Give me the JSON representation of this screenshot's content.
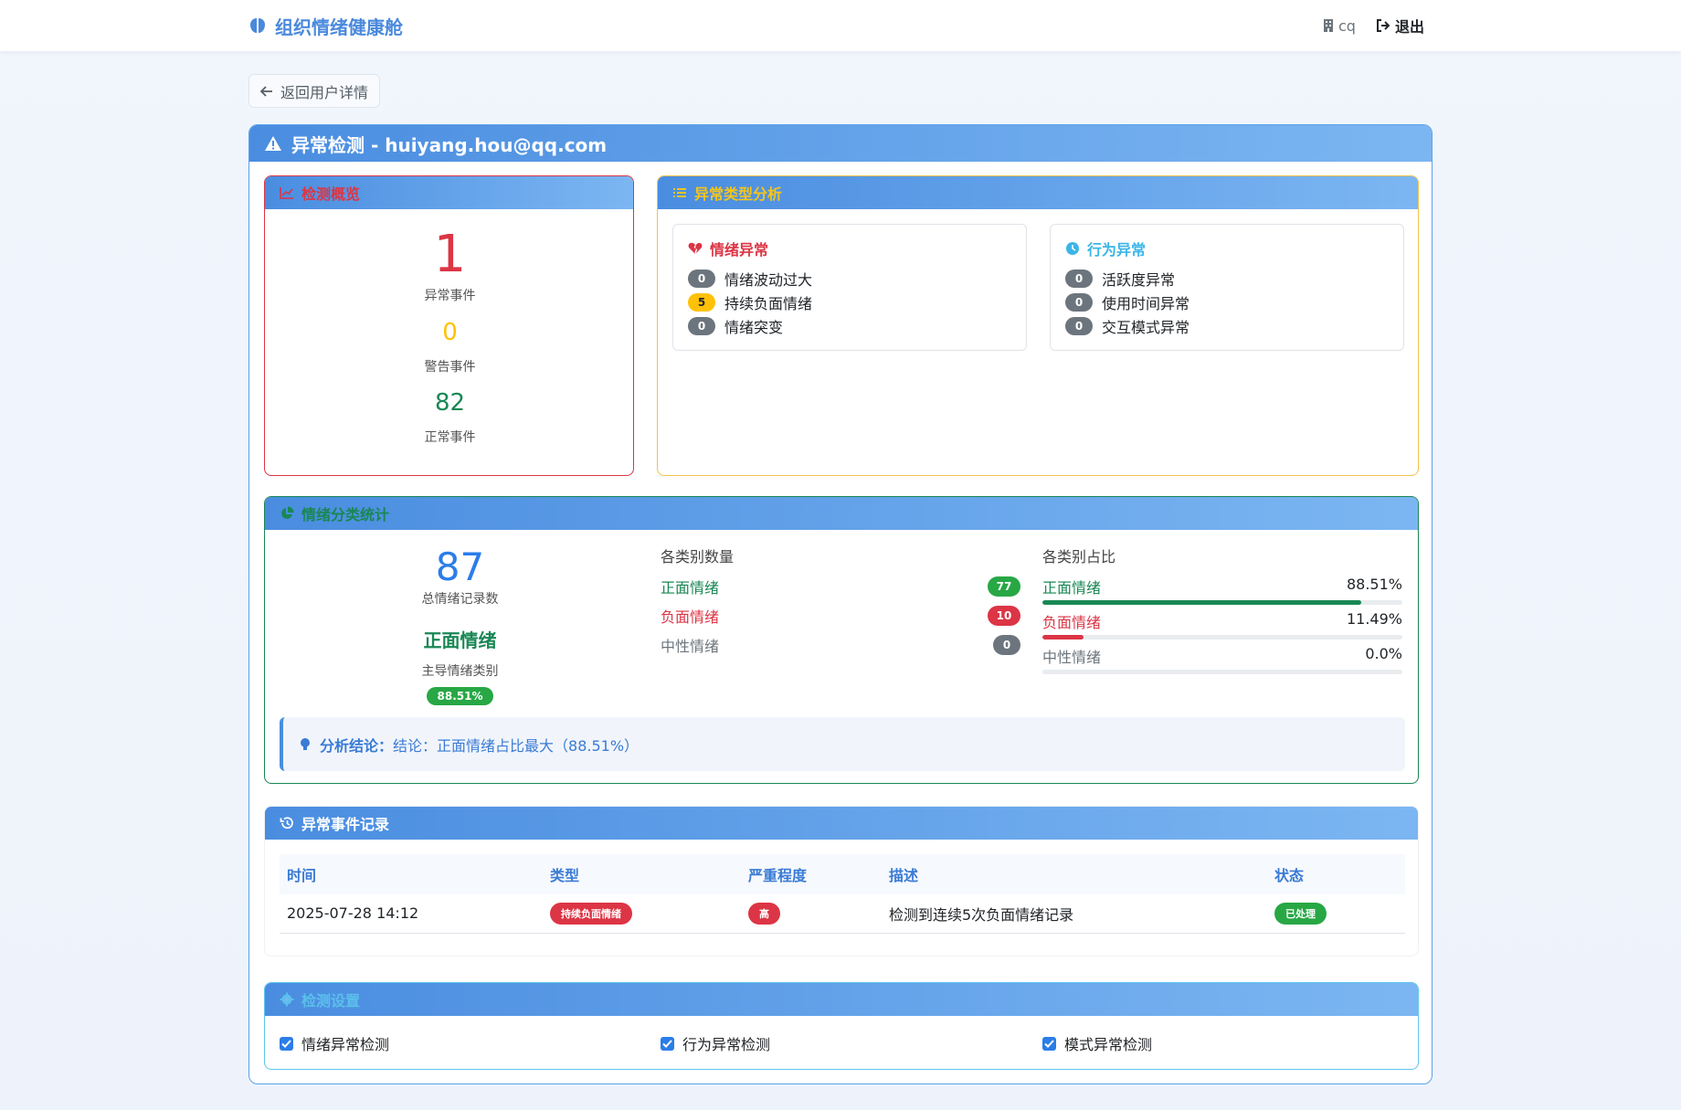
{
  "nav": {
    "brand": "组织情绪健康舱",
    "user": "cq",
    "logout": "退出"
  },
  "back": {
    "label": "返回用户详情"
  },
  "main": {
    "title": "异常检测 - huiyang.hou@qq.com"
  },
  "overview": {
    "title": "检测概览",
    "stats": [
      {
        "value": "1",
        "label": "异常事件",
        "color": "#dc3545"
      },
      {
        "value": "0",
        "label": "警告事件",
        "color": "#ffc107"
      },
      {
        "value": "82",
        "label": "正常事件",
        "color": "#198754"
      }
    ]
  },
  "types": {
    "title": "异常类型分析",
    "emotion": {
      "title": "情绪异常",
      "items": [
        {
          "count": "0",
          "label": "情绪波动过大"
        },
        {
          "count": "5",
          "label": "持续负面情绪"
        },
        {
          "count": "0",
          "label": "情绪突变"
        }
      ]
    },
    "behavior": {
      "title": "行为异常",
      "items": [
        {
          "count": "0",
          "label": "活跃度异常"
        },
        {
          "count": "0",
          "label": "使用时间异常"
        },
        {
          "count": "0",
          "label": "交互模式异常"
        }
      ]
    }
  },
  "emotion_stats": {
    "title": "情绪分类统计",
    "total": "87",
    "total_label": "总情绪记录数",
    "main_category": "正面情绪",
    "main_label": "主导情绪类别",
    "main_pct": "88.51%",
    "count_title": "各类别数量",
    "pct_title": "各类别占比",
    "categories": [
      {
        "name": "正面情绪",
        "count": "77",
        "pct": "88.51%",
        "fraction": 0.8851,
        "color": "#198754",
        "badge": "#28a745"
      },
      {
        "name": "负面情绪",
        "count": "10",
        "pct": "11.49%",
        "fraction": 0.1149,
        "color": "#dc3545",
        "badge": "#dc3545"
      },
      {
        "name": "中性情绪",
        "count": "0",
        "pct": "0.0%",
        "fraction": 0.0,
        "color": "#6c757d",
        "badge": "#6c757d"
      }
    ],
    "conclusion_label": "分析结论：",
    "conclusion": "结论：正面情绪占比最大（88.51%）"
  },
  "records": {
    "title": "异常事件记录",
    "columns": [
      "时间",
      "类型",
      "严重程度",
      "描述",
      "状态"
    ],
    "rows": [
      {
        "time": "2025-07-28 14:12",
        "type": "持续负面情绪",
        "severity": "高",
        "desc": "检测到连续5次负面情绪记录",
        "status": "已处理"
      }
    ]
  },
  "settings": {
    "title": "检测设置",
    "options": [
      {
        "label": "情绪异常检测",
        "checked": true
      },
      {
        "label": "行为异常检测",
        "checked": true
      },
      {
        "label": "模式异常检测",
        "checked": true
      }
    ]
  },
  "colors": {
    "primary": "#4a8de0",
    "danger": "#dc3545",
    "warning": "#ffc107",
    "success": "#198754",
    "info": "#5bc0eb"
  }
}
